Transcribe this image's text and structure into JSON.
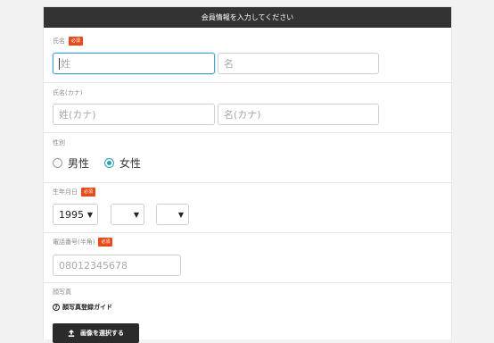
{
  "form": {
    "title": "会員情報を入力してください",
    "required_badge": "必須",
    "name": {
      "label": "氏名",
      "last_placeholder": "姓",
      "first_placeholder": "名"
    },
    "kana": {
      "label": "氏名(カナ)",
      "last_placeholder": "姓(カナ)",
      "first_placeholder": "名(カナ)"
    },
    "gender": {
      "label": "性別",
      "options": [
        "男性",
        "女性"
      ],
      "selected": "女性"
    },
    "birthdate": {
      "label": "生年月日",
      "year": "1995",
      "month": "",
      "day": ""
    },
    "phone": {
      "label": "電話番号(半角)",
      "placeholder": "08012345678"
    },
    "photo": {
      "label": "顔写真",
      "guide_link": "顔写真登録ガイド",
      "upload_button": "画像を選択する"
    }
  },
  "colors": {
    "header_bg": "#333333",
    "required_badge": "#e64a19",
    "accent": "#2a9fb8",
    "focus_border": "#4aa3c9"
  }
}
